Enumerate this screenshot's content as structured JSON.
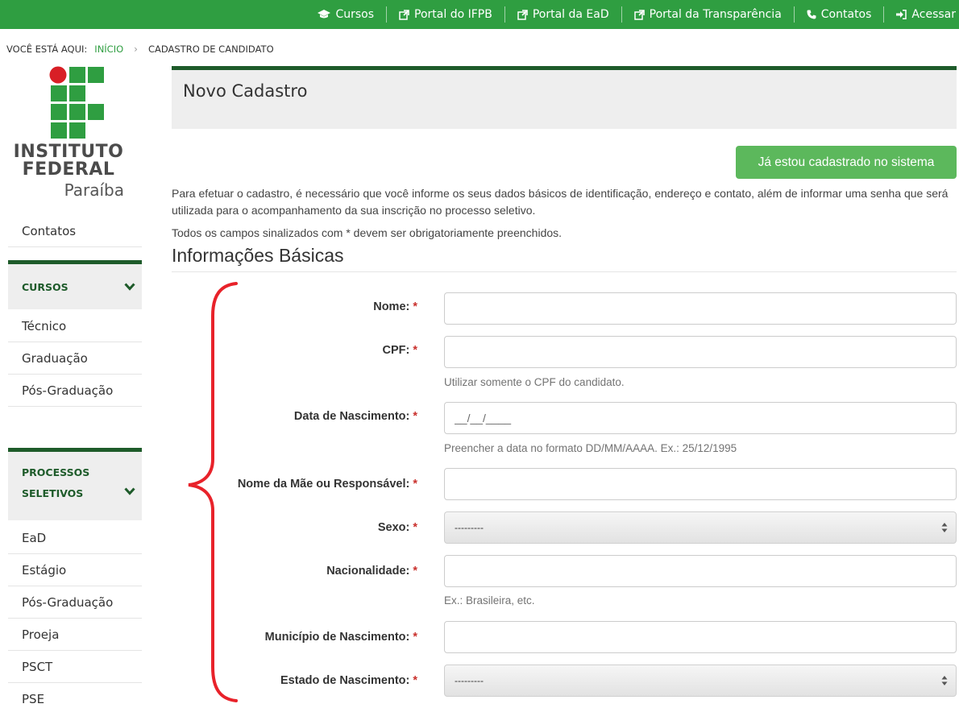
{
  "colors": {
    "brand_green": "#2f9e41",
    "dark_green": "#1e5b2a",
    "button_green": "#5cb85c",
    "required_red": "#c9302c",
    "annotation_red": "#e8222a"
  },
  "topbar": {
    "links": [
      {
        "label": "Cursos",
        "icon": "graduation-cap-icon"
      },
      {
        "label": "Portal do IFPB",
        "icon": "external-link-icon"
      },
      {
        "label": "Portal da EaD",
        "icon": "external-link-icon"
      },
      {
        "label": "Portal da Transparência",
        "icon": "external-link-icon"
      },
      {
        "label": "Contatos",
        "icon": "phone-icon"
      },
      {
        "label": "Acessar",
        "icon": "sign-in-icon"
      }
    ]
  },
  "breadcrumb": {
    "prefix": "VOCÊ ESTÁ AQUI:",
    "home": "INÍCIO",
    "separator": "›",
    "current": "CADASTRO DE CANDIDATO"
  },
  "logo": {
    "line1": "INSTITUTO",
    "line2": "FEDERAL",
    "line3": "Paraíba"
  },
  "sidebar": {
    "top_item": "Contatos",
    "cursos": {
      "header": "CURSOS",
      "items": [
        "Técnico",
        "Graduação",
        "Pós-Graduação"
      ]
    },
    "processos": {
      "header_line1": "PROCESSOS",
      "header_line2": "SELETIVOS",
      "items": [
        "EaD",
        "Estágio",
        "Pós-Graduação",
        "Proeja",
        "PSCT",
        "PSE"
      ]
    }
  },
  "main": {
    "panel_title": "Novo Cadastro",
    "registered_button": "Já estou cadastrado no sistema",
    "intro": "Para efetuar o cadastro, é necessário que você informe os seus dados básicos de identificação, endereço e contato, além de informar uma senha que será utilizada para o acompanhamento da sua inscrição no processo seletivo.",
    "required_note": "Todos os campos sinalizados com * devem ser obrigatoriamente preenchidos.",
    "section_title": "Informações Básicas",
    "required_marker": "*",
    "fields": {
      "nome": {
        "label": "Nome:",
        "value": ""
      },
      "cpf": {
        "label": "CPF:",
        "value": "",
        "help": "Utilizar somente o CPF do candidato."
      },
      "nascimento": {
        "label": "Data de Nascimento:",
        "value": "__/__/____",
        "help": "Preencher a data no formato DD/MM/AAAA. Ex.: 25/12/1995"
      },
      "mae": {
        "label": "Nome da Mãe ou Responsável:",
        "value": ""
      },
      "sexo": {
        "label": "Sexo:",
        "selected": "---------"
      },
      "nacionalidade": {
        "label": "Nacionalidade:",
        "value": "",
        "help": "Ex.: Brasileira, etc."
      },
      "municipio": {
        "label": "Município de Nascimento:",
        "value": ""
      },
      "estado": {
        "label": "Estado de Nascimento:",
        "selected": "---------"
      }
    }
  }
}
